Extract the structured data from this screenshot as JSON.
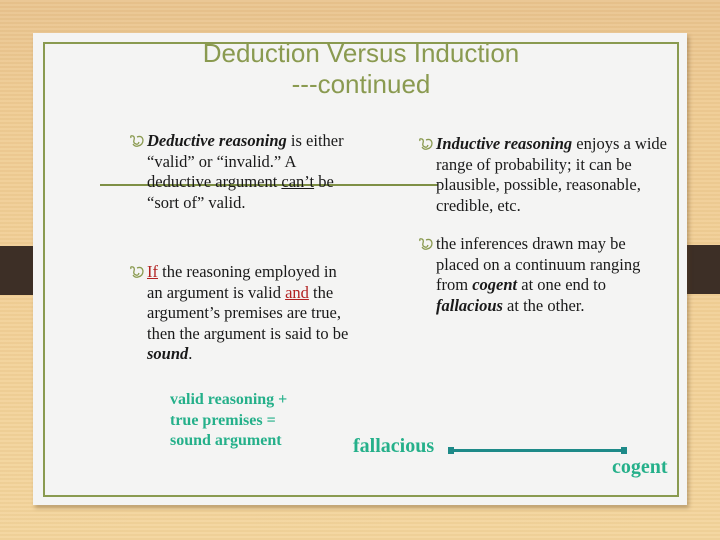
{
  "slide": {
    "title_line1": "Deduction Versus Induction",
    "title_line2": "---continued"
  },
  "left_column": {
    "bullet1": {
      "term": "Deductive reasoning",
      "text1": " is either “valid” or “invalid.” A deductive argument ",
      "emphasis": "can’t",
      "text2": " be “sort of” valid."
    },
    "bullet2": {
      "if_word": "If",
      "text1": " the reasoning employed in an argument is valid ",
      "and_word": "and",
      "text2": " the argument’s premises are true, then the argument is said to be ",
      "term": "sound",
      "text3": "."
    },
    "formula": {
      "line1": "valid reasoning +",
      "line2": "true premises =",
      "line3": "sound argument"
    }
  },
  "right_column": {
    "bullet1": {
      "term": "Inductive reasoning",
      "text": " enjoys a wide range of probability; it can be plausible, possible, reasonable, credible, etc."
    },
    "bullet2": {
      "text1": "the inferences drawn may be placed on a continuum ranging from ",
      "term1": "cogent",
      "text2": " at one end to ",
      "term2": "fallacious",
      "text3": " at the other."
    }
  },
  "continuum": {
    "left_label": "fallacious",
    "right_label": "cogent"
  },
  "colors": {
    "accent_olive": "#8a9a50",
    "emphasis_red": "#b22222",
    "continuum_teal": "#25b08a"
  }
}
